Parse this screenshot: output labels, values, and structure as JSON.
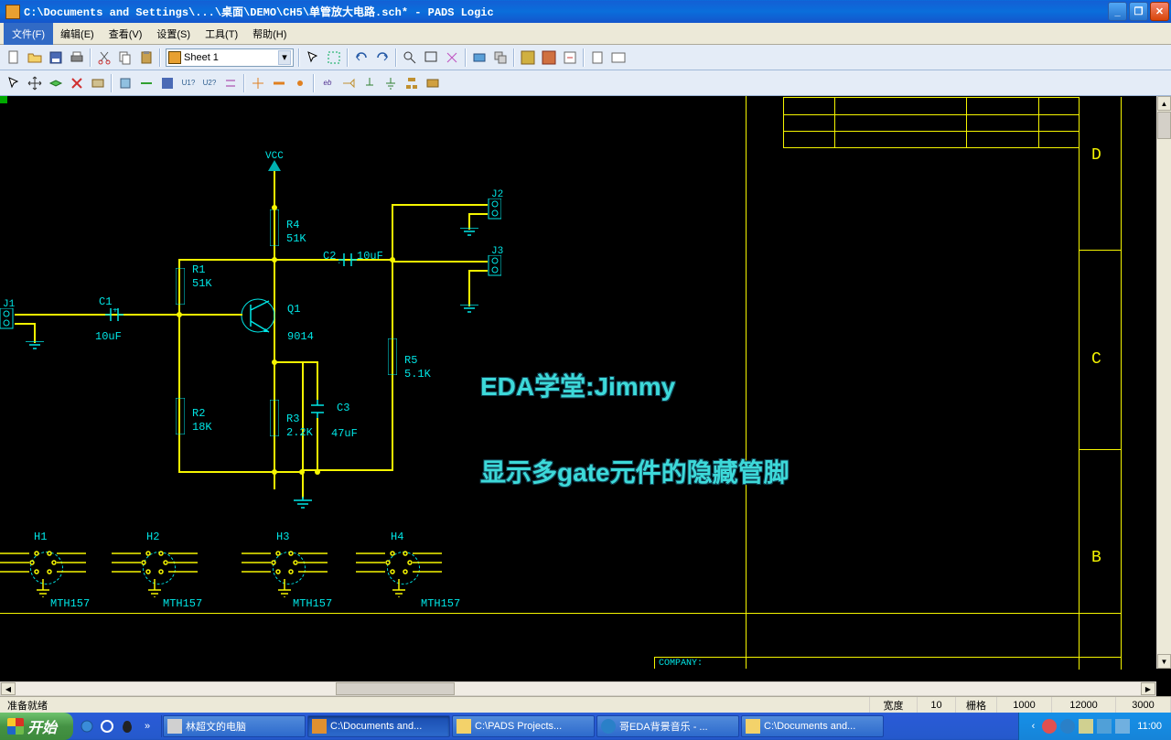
{
  "titlebar": {
    "path": "C:\\Documents and Settings\\...\\桌面\\DEMO\\CH5\\单管放大电路.sch* - PADS Logic"
  },
  "menu": {
    "file": "文件(F)",
    "edit": "编辑(E)",
    "view": "查看(V)",
    "setup": "设置(S)",
    "tools": "工具(T)",
    "help": "帮助(H)"
  },
  "toolbar": {
    "sheet_combo": "Sheet 1"
  },
  "schematic": {
    "vcc": "VCC",
    "r1_ref": "R1",
    "r1_val": "51K",
    "r2_ref": "R2",
    "r2_val": "18K",
    "r3_ref": "R3",
    "r3_val": "2.2K",
    "r4_ref": "R4",
    "r4_val": "51K",
    "r5_ref": "R5",
    "r5_val": "5.1K",
    "c1_ref": "C1",
    "c1_val": "10uF",
    "c2_ref": "C2",
    "c2_val": "10uF",
    "c3_ref": "C3",
    "c3_val": "47uF",
    "q1_ref": "Q1",
    "q1_val": "9014",
    "j1_ref": "J1",
    "j2_ref": "J2",
    "j3_ref": "J3",
    "h1_ref": "H1",
    "h2_ref": "H2",
    "h3_ref": "H3",
    "h4_ref": "H4",
    "mth": "MTH157",
    "annot1": "EDA学堂:Jimmy",
    "annot2": "显示多gate元件的隐藏管脚",
    "letter_d": "D",
    "letter_c": "C",
    "letter_b": "B",
    "company": "COMPANY:"
  },
  "status": {
    "ready": "准备就绪",
    "width_label": "宽度",
    "grid_label": "栅格",
    "width": "10",
    "grid": "1000",
    "x": "12000",
    "y": "3000"
  },
  "taskbar": {
    "start": "开始",
    "t1": "林超文的电脑",
    "t2": "C:\\Documents and...",
    "t3": "C:\\PADS Projects...",
    "t4": "哥EDA背景音乐 - ...",
    "t5": "C:\\Documents and...",
    "time": "11:00"
  }
}
